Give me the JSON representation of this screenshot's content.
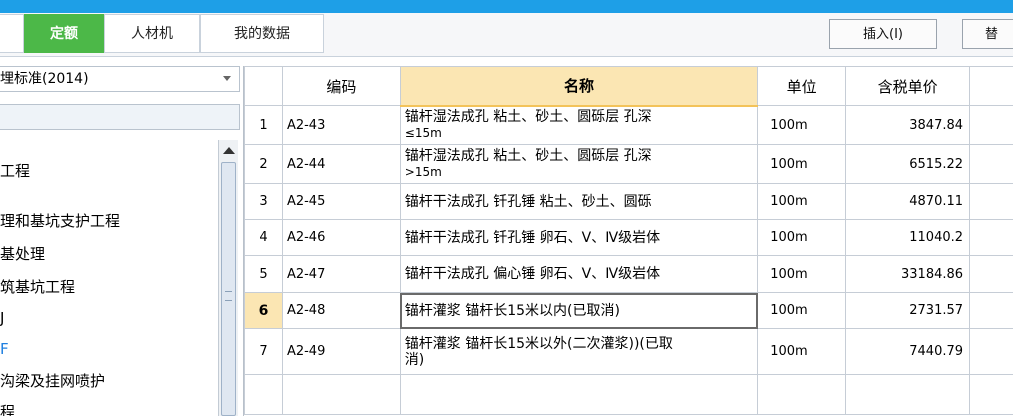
{
  "tabs": [
    {
      "label": "定额",
      "active": true
    },
    {
      "label": "人材机",
      "active": false
    },
    {
      "label": "我的数据",
      "active": false
    }
  ],
  "toolbar": {
    "insert_label": "插入(I)",
    "replace_label": "替"
  },
  "left": {
    "select_value": "埋标准(2014)",
    "tree": [
      {
        "label": "工程",
        "selected": false
      },
      {
        "label": "理和基坑支护工程",
        "selected": false
      },
      {
        "label": "基处理",
        "selected": false
      },
      {
        "label": "筑基坑工程",
        "selected": false
      },
      {
        "label": "J",
        "selected": false
      },
      {
        "label": "F",
        "selected": true
      },
      {
        "label": "沟梁及挂网喷护",
        "selected": false
      },
      {
        "label": "程",
        "selected": false
      }
    ]
  },
  "grid": {
    "headers": {
      "code": "编码",
      "name": "名称",
      "unit": "单位",
      "price": "含税单价"
    },
    "rows": [
      {
        "no": "1",
        "code": "A2-43",
        "name": "锚杆湿法成孔 粘土、砂土、圆砾层 孔深",
        "name2": "≤15m",
        "unit": "100m",
        "price": "3847.84"
      },
      {
        "no": "2",
        "code": "A2-44",
        "name": "锚杆湿法成孔 粘土、砂土、圆砾层 孔深",
        "name2": ">15m",
        "unit": "100m",
        "price": "6515.22"
      },
      {
        "no": "3",
        "code": "A2-45",
        "name": "锚杆干法成孔 钎孔锤 粘土、砂土、圆砾",
        "name2": "",
        "unit": "100m",
        "price": "4870.11"
      },
      {
        "no": "4",
        "code": "A2-46",
        "name": "锚杆干法成孔 钎孔锤 卵石、Ⅴ、Ⅳ级岩体",
        "name2": "",
        "unit": "100m",
        "price": "11040.2"
      },
      {
        "no": "5",
        "code": "A2-47",
        "name": "锚杆干法成孔 偏心锤 卵石、Ⅴ、Ⅳ级岩体",
        "name2": "",
        "unit": "100m",
        "price": "33184.86"
      },
      {
        "no": "6",
        "code": "A2-48",
        "name": "锚杆灌浆 锚杆长15米以内(已取消)",
        "name2": "",
        "unit": "100m",
        "price": "2731.57",
        "selected": true
      },
      {
        "no": "7",
        "code": "A2-49",
        "name": "锚杆灌浆 锚杆长15米以外(二次灌浆))(已取",
        "name2": "消)",
        "unit": "100m",
        "price": "7440.79"
      }
    ]
  },
  "colors": {
    "accent_green": "#4cb848",
    "header_highlight": "#fbe6b3",
    "top_bar": "#1e9fe7"
  }
}
